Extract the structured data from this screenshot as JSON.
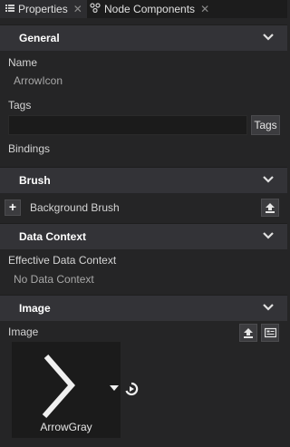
{
  "tabs": [
    {
      "label": "Properties",
      "icon": "list-icon",
      "close": "✕"
    },
    {
      "label": "Node Components",
      "icon": "components-icon",
      "close": "✕"
    }
  ],
  "sections": {
    "general": "General",
    "brush": "Brush",
    "data_context": "Data Context",
    "image": "Image"
  },
  "general": {
    "name_label": "Name",
    "name_value": "ArrowIcon",
    "tags_label": "Tags",
    "tags_value": "",
    "tags_button": "Tags",
    "bindings_label": "Bindings"
  },
  "brush": {
    "add_symbol": "+",
    "background_label": "Background Brush"
  },
  "data_context": {
    "effective_label": "Effective Data Context",
    "effective_value": "No Data Context"
  },
  "image": {
    "property_label": "Image",
    "thumbnail_caption": "ArrowGray"
  },
  "colors": {
    "panel_bg": "#252526",
    "section_bg": "#333337",
    "field_bg": "#1b1b1b",
    "text": "#d4d4d4",
    "muted_text": "#a8a8a8"
  }
}
